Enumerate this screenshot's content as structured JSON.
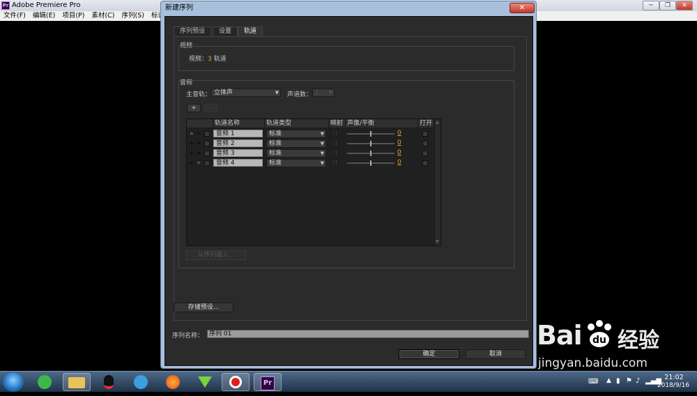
{
  "app": {
    "logo_text": "Pr",
    "title": "Adobe Premiere Pro",
    "minimize": "─",
    "restore": "❐",
    "close": "✕"
  },
  "menu": [
    "文件(F)",
    "编辑(E)",
    "项目(P)",
    "素材(C)",
    "序列(S)",
    "标记(M)"
  ],
  "dialog": {
    "title": "新建序列",
    "close": "✕",
    "tabs": [
      "序列预设",
      "设置",
      "轨道"
    ],
    "active_tab": 2,
    "video": {
      "group_label": "视频",
      "prefix": "视频：",
      "count": "3",
      "suffix": " 轨道"
    },
    "audio": {
      "group_label": "音频",
      "master_label": "主音轨：",
      "master_value": "立体声",
      "channels_label": "声道数：",
      "channels_value": "2",
      "add_btn": "+",
      "remove_btn": "-",
      "columns": [
        "轨道名称",
        "轨道类型",
        "映射",
        "声像/平衡",
        "打开"
      ],
      "tracks": [
        {
          "name": "音频 1",
          "type": "标准",
          "pan": "0"
        },
        {
          "name": "音频 2",
          "type": "标准",
          "pan": "0"
        },
        {
          "name": "音频 3",
          "type": "标准",
          "pan": "0"
        },
        {
          "name": "音频 4",
          "type": "标准",
          "pan": "0"
        }
      ],
      "load_btn": "从序列载入..."
    },
    "save_preset": "存储预设...",
    "seq_name_label": "序列名称：",
    "seq_name_value": "序列 01",
    "ok": "确定",
    "cancel": "取消"
  },
  "taskbar": {
    "time": "21:02",
    "date": "2018/9/16",
    "pr_label": "Pr"
  },
  "watermark": {
    "brand": "Bai",
    "brand2": "经验",
    "url": "jingyan.baidu.com"
  }
}
